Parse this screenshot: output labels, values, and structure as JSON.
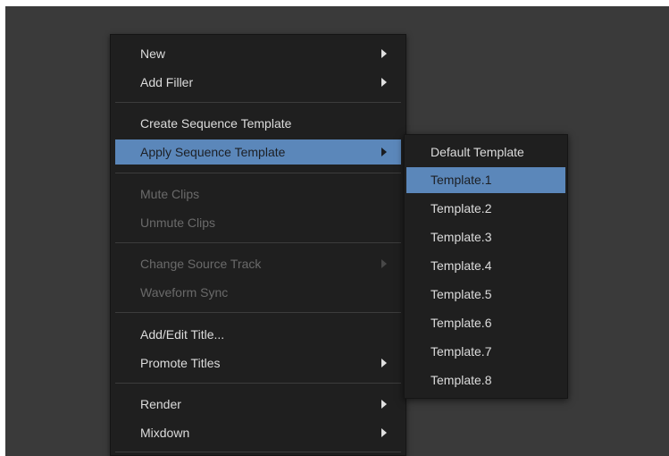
{
  "context_menu": {
    "items": [
      {
        "label": "New",
        "has_submenu": true,
        "enabled": true
      },
      {
        "label": "Add Filler",
        "has_submenu": true,
        "enabled": true
      },
      {
        "label": "Create Sequence Template",
        "has_submenu": false,
        "enabled": true
      },
      {
        "label": "Apply Sequence Template",
        "has_submenu": true,
        "enabled": true,
        "highlighted": true
      },
      {
        "label": "Mute Clips",
        "has_submenu": false,
        "enabled": false
      },
      {
        "label": "Unmute Clips",
        "has_submenu": false,
        "enabled": false
      },
      {
        "label": "Change Source Track",
        "has_submenu": true,
        "enabled": false
      },
      {
        "label": "Waveform Sync",
        "has_submenu": false,
        "enabled": false
      },
      {
        "label": "Add/Edit Title...",
        "has_submenu": false,
        "enabled": true
      },
      {
        "label": "Promote Titles",
        "has_submenu": true,
        "enabled": true
      },
      {
        "label": "Render",
        "has_submenu": true,
        "enabled": true
      },
      {
        "label": "Mixdown",
        "has_submenu": true,
        "enabled": true
      }
    ]
  },
  "template_submenu": {
    "items": [
      {
        "label": "Default Template"
      },
      {
        "label": "Template.1",
        "highlighted": true
      },
      {
        "label": "Template.2"
      },
      {
        "label": "Template.3"
      },
      {
        "label": "Template.4"
      },
      {
        "label": "Template.5"
      },
      {
        "label": "Template.6"
      },
      {
        "label": "Template.7"
      },
      {
        "label": "Template.8"
      }
    ]
  },
  "colors": {
    "background": "#3a3a3a",
    "menu_background": "#1f1f1f",
    "highlight": "#5b87ba",
    "text": "#dcdcdc",
    "disabled_text": "#6a6a6a"
  }
}
